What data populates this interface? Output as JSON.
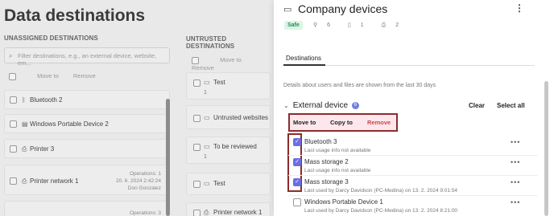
{
  "page": {
    "title": "Data destinations",
    "unassigned_title": "UNASSIGNED DESTINATIONS",
    "untrusted_title": "UNTRUSTED DESTINATIONS",
    "search_placeholder": "Filter destinations, e.g., an external device, website, em...",
    "move_to": "Move to",
    "remove": "Remove"
  },
  "left_rows": [
    {
      "label": "Bluetooth 2",
      "icon": "bluetooth-icon"
    },
    {
      "label": "Windows Portable Device 2",
      "icon": "device-icon"
    },
    {
      "label": "Printer 3",
      "icon": "printer-icon"
    },
    {
      "label": "Printer network 1",
      "icon": "printer-icon",
      "meta1": "Operations: 1",
      "meta2": "20. 6. 2024 2:42:24",
      "meta3": "Don Gonzalez"
    },
    {
      "label": "",
      "meta1": "Operations: 3"
    }
  ],
  "mid_rows": [
    {
      "label": "Test",
      "sub": "1"
    },
    {
      "label": "Untrusted websites"
    },
    {
      "label": "To be reviewed",
      "sub": "1"
    },
    {
      "label": "Test"
    },
    {
      "label": "Printer network 1"
    }
  ],
  "panel": {
    "title": "Company devices",
    "safe": "Safe",
    "stat_devices": "6",
    "stat_files": "1",
    "stat_printers": "2",
    "tab": "Destinations",
    "info": "Details about users and files are shown from the last 30 days",
    "section_title": "External device",
    "section_count": "6",
    "clear": "Clear",
    "select_all": "Select all",
    "action_move": "Move to",
    "action_copy": "Copy to",
    "action_remove": "Remove",
    "colors": {
      "accent": "#6b6ee3",
      "remove": "#d0464b",
      "highlight": "#8b2c2c",
      "safe_bg": "#dcf5e6",
      "safe_fg": "#2c8c54"
    }
  },
  "devices": [
    {
      "name": "Bluetooth 3",
      "sub": "Last usage info not available",
      "checked": true
    },
    {
      "name": "Mass storage 2",
      "sub": "Last usage info not available",
      "checked": true
    },
    {
      "name": "Mass storage 3",
      "sub": "Last used by Darcy Davidson (PC-Medina) on 13. 2. 2024 9:01:54",
      "checked": true
    },
    {
      "name": "Windows Portable Device 1",
      "sub": "Last used by Darcy Davidson (PC-Medina) on 13. 2. 2024 8:21:00",
      "checked": false
    }
  ]
}
